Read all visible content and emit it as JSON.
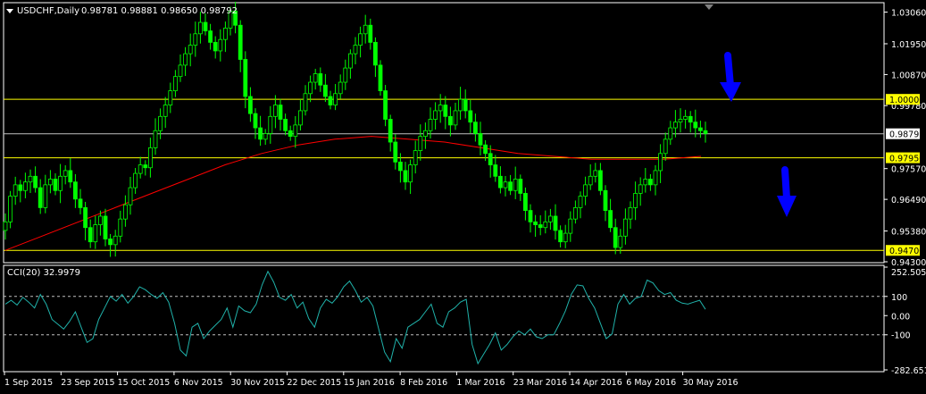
{
  "header": {
    "symbol_label": "USDCHF,Daily",
    "ohlc_label": "0.98781 0.98881 0.98650 0.98792"
  },
  "indicator": {
    "label": "CCI(20) 32.9979",
    "scale_labels": [
      "252.5056",
      "100",
      "0.00",
      "-100",
      "-282.6519"
    ]
  },
  "colors": {
    "background": "#000000",
    "frame": "#ffffff",
    "candle": "#00ff00",
    "moving_average": "#ff0000",
    "level_line": "#ffff00",
    "price_line": "#c0c0c0",
    "cci_line": "#20b2aa",
    "arrow": "#0000ff"
  },
  "icons": {
    "arrows": [
      "arrow-down-icon",
      "arrow-down-icon"
    ]
  },
  "chart_data": {
    "type": "candlestick",
    "title": "USDCHF,Daily",
    "price_axis_labels": [
      "1.03060",
      "1.01950",
      "1.00870",
      "0.99780",
      "0.97570",
      "0.96490",
      "0.95380",
      "0.94300"
    ],
    "ylim": [
      0.943,
      1.0336
    ],
    "date_labels": [
      "1 Sep 2015",
      "23 Sep 2015",
      "15 Oct 2015",
      "6 Nov 2015",
      "30 Nov 2015",
      "22 Dec 2015",
      "15 Jan 2016",
      "8 Feb 2016",
      "1 Mar 2016",
      "23 Mar 2016",
      "14 Apr 2016",
      "6 May 2016",
      "30 May 2016"
    ],
    "horizontal_levels": [
      {
        "value": "1.00000",
        "price": 1.0
      },
      {
        "value": "0.97950",
        "price": 0.9795
      },
      {
        "value": "0.94700",
        "price": 0.947
      }
    ],
    "current_price": {
      "value": "0.98792",
      "price": 0.98792
    },
    "close_series": [
      0.957,
      0.966,
      0.97,
      0.968,
      0.971,
      0.973,
      0.969,
      0.962,
      0.97,
      0.972,
      0.968,
      0.973,
      0.975,
      0.971,
      0.965,
      0.962,
      0.955,
      0.95,
      0.956,
      0.959,
      0.951,
      0.949,
      0.952,
      0.958,
      0.963,
      0.969,
      0.974,
      0.977,
      0.976,
      0.983,
      0.989,
      0.994,
      0.998,
      1.003,
      1.008,
      1.012,
      1.016,
      1.019,
      1.023,
      1.027,
      1.024,
      1.02,
      1.017,
      1.021,
      1.025,
      1.031,
      1.026,
      1.014,
      1.001,
      0.995,
      0.99,
      0.986,
      0.988,
      0.994,
      0.998,
      0.993,
      0.989,
      0.987,
      0.991,
      0.996,
      1.002,
      1.006,
      1.009,
      1.005,
      1.001,
      0.998,
      1.002,
      1.006,
      1.011,
      1.016,
      1.019,
      1.023,
      1.026,
      1.02,
      1.012,
      1.003,
      0.993,
      0.985,
      0.978,
      0.975,
      0.971,
      0.977,
      0.982,
      0.987,
      0.989,
      0.993,
      0.996,
      0.998,
      0.994,
      0.991,
      0.996,
      1.0,
      0.996,
      0.992,
      0.988,
      0.984,
      0.981,
      0.977,
      0.973,
      0.969,
      0.971,
      0.968,
      0.972,
      0.967,
      0.961,
      0.957,
      0.956,
      0.955,
      0.957,
      0.959,
      0.954,
      0.95,
      0.953,
      0.958,
      0.962,
      0.966,
      0.97,
      0.973,
      0.975,
      0.968,
      0.961,
      0.955,
      0.948,
      0.952,
      0.958,
      0.962,
      0.967,
      0.97,
      0.972,
      0.97,
      0.975,
      0.981,
      0.986,
      0.99,
      0.992,
      0.993,
      0.994,
      0.992,
      0.99,
      0.989,
      0.988
    ],
    "ma_series": [
      0.947,
      0.952,
      0.957,
      0.962,
      0.967,
      0.972,
      0.977,
      0.981,
      0.984,
      0.986,
      0.987,
      0.986,
      0.985,
      0.983,
      0.981,
      0.98,
      0.979,
      0.979,
      0.979,
      0.98
    ],
    "cci": {
      "period": 20,
      "last": 32.9979,
      "levels": [
        100,
        -100
      ],
      "ylim": [
        -282.6519,
        252.5056
      ],
      "values": [
        60,
        80,
        55,
        95,
        70,
        40,
        110,
        60,
        -20,
        -45,
        -70,
        -30,
        20,
        -60,
        -140,
        -120,
        -20,
        40,
        100,
        75,
        110,
        65,
        100,
        150,
        135,
        110,
        90,
        120,
        70,
        -40,
        -180,
        -210,
        -60,
        -40,
        -120,
        -80,
        -50,
        -20,
        40,
        -60,
        50,
        25,
        15,
        60,
        160,
        230,
        175,
        95,
        80,
        110,
        40,
        70,
        -15,
        -60,
        40,
        85,
        65,
        100,
        150,
        180,
        130,
        70,
        95,
        50,
        -70,
        -190,
        -240,
        -120,
        -170,
        -60,
        -40,
        -20,
        20,
        60,
        -40,
        -60,
        20,
        40,
        70,
        85,
        -150,
        -250,
        -200,
        -150,
        -90,
        -180,
        -150,
        -110,
        -80,
        -100,
        -70,
        -110,
        -120,
        -100,
        -100,
        -40,
        25,
        110,
        160,
        155,
        90,
        40,
        -40,
        -120,
        -95,
        60,
        110,
        60,
        90,
        100,
        185,
        170,
        130,
        110,
        120,
        80,
        65,
        60,
        70,
        80,
        33
      ]
    }
  }
}
